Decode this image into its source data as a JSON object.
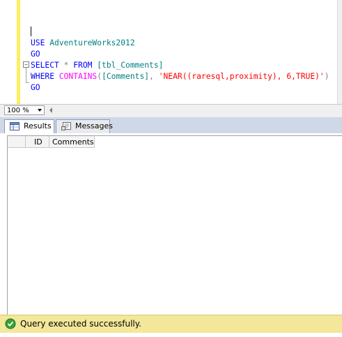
{
  "editor": {
    "lines": [
      {
        "parts": [
          {
            "t": "USE",
            "c": "kw"
          },
          {
            "t": " AdventureWorks2012",
            "c": "id"
          }
        ]
      },
      {
        "parts": [
          {
            "t": "GO",
            "c": "kw"
          }
        ]
      },
      {
        "parts": [
          {
            "t": "SELECT",
            "c": "kw"
          },
          {
            "t": " * ",
            "c": "op"
          },
          {
            "t": "FROM",
            "c": "kw"
          },
          {
            "t": " [tbl_Comments]",
            "c": "id"
          }
        ]
      },
      {
        "parts": [
          {
            "t": "WHERE",
            "c": "kw"
          },
          {
            "t": " ",
            "c": ""
          },
          {
            "t": "CONTAINS",
            "c": "fn"
          },
          {
            "t": "(",
            "c": "op"
          },
          {
            "t": "[Comments]",
            "c": "id"
          },
          {
            "t": ", ",
            "c": "op"
          },
          {
            "t": "'NEAR((raresql,proximity), 6,TRUE)'",
            "c": "str"
          },
          {
            "t": ")",
            "c": "op"
          }
        ]
      },
      {
        "parts": [
          {
            "t": "GO",
            "c": "kw"
          }
        ]
      }
    ],
    "collapse_glyph": "−"
  },
  "zoom": {
    "value": "100 %"
  },
  "tabs": {
    "results_label": "Results",
    "messages_label": "Messages"
  },
  "grid": {
    "columns": [
      "ID",
      "Comments"
    ]
  },
  "status": {
    "text": "Query executed successfully."
  },
  "colors": {
    "margin_yellow": "#ffee62",
    "status_bg": "#f3e79a",
    "keyword": "#0000ff",
    "string": "#ff0000",
    "function": "#ff00ff",
    "identifier": "#008080"
  }
}
